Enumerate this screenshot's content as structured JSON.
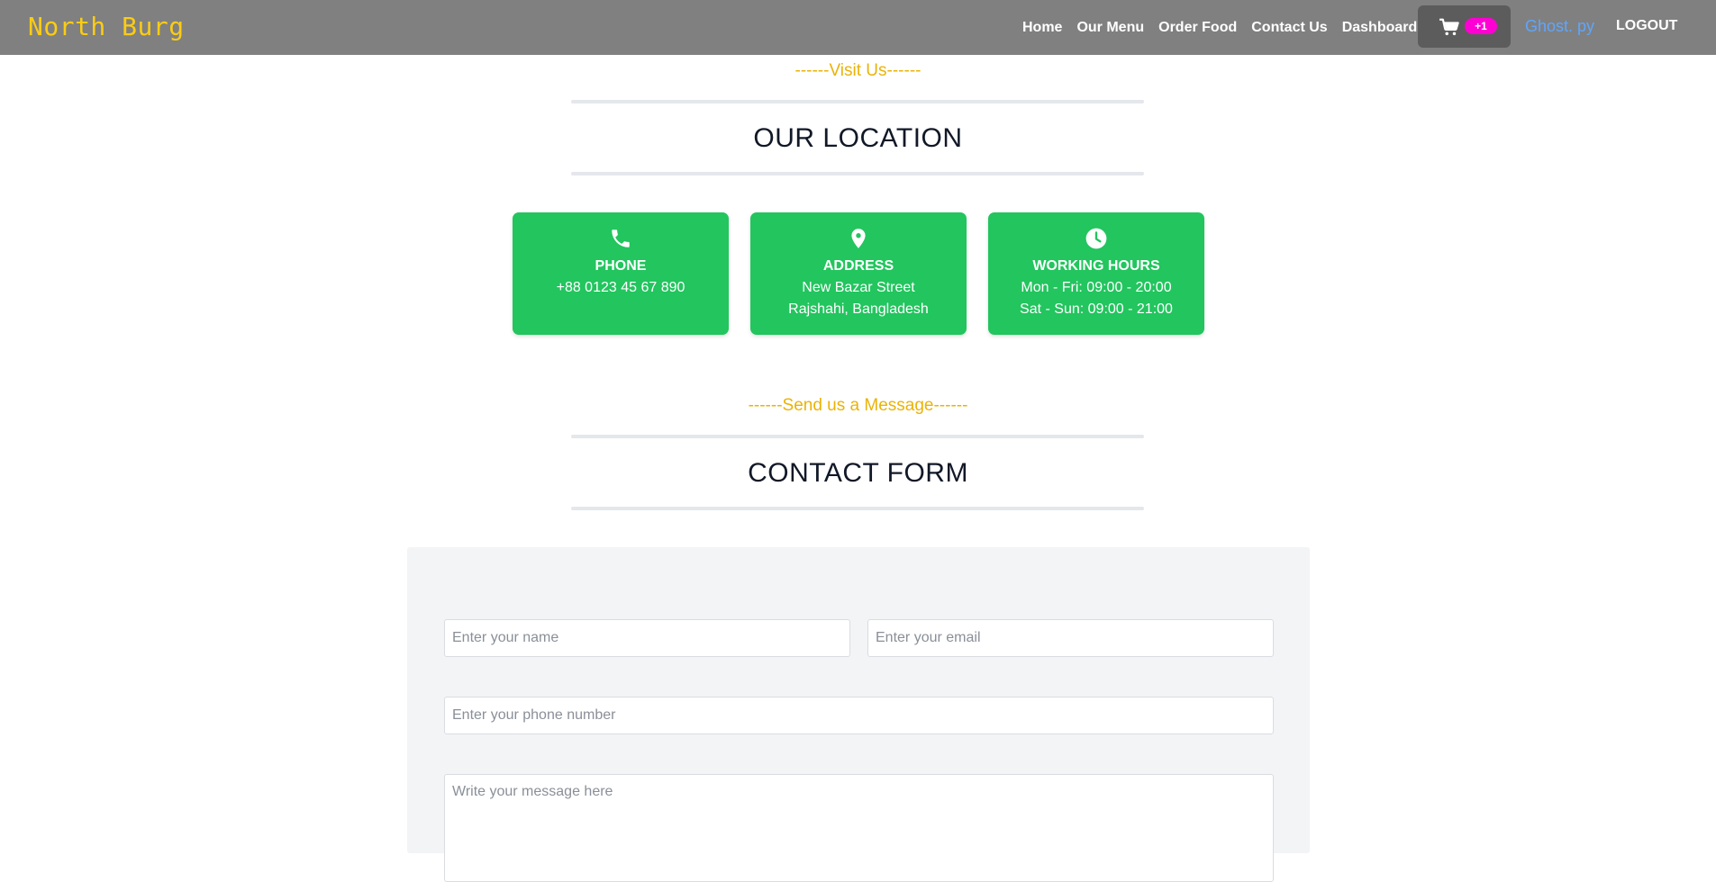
{
  "nav": {
    "brand": "North Burg",
    "links": [
      "Home",
      "Our Menu",
      "Order Food",
      "Contact Us",
      "Dashboard"
    ],
    "cart_icon": "cart-icon",
    "cart_badge": "+1",
    "user": "Ghost. py",
    "logout": "LOGOUT"
  },
  "location_section": {
    "eyebrow": "------Visit Us------",
    "title": "OUR LOCATION"
  },
  "cards": [
    {
      "icon": "phone-icon",
      "title": "PHONE",
      "lines": [
        "+88 0123 45 67 890"
      ]
    },
    {
      "icon": "map-pin-icon",
      "title": "ADDRESS",
      "lines": [
        "New Bazar Street",
        "Rajshahi, Bangladesh"
      ]
    },
    {
      "icon": "clock-icon",
      "title": "WORKING HOURS",
      "lines": [
        "Mon - Fri: 09:00 - 20:00",
        "Sat - Sun: 09:00 - 21:00"
      ]
    }
  ],
  "contact_section": {
    "eyebrow": "------Send us a Message------",
    "title": "CONTACT FORM"
  },
  "form": {
    "name_placeholder": "Enter your name",
    "email_placeholder": "Enter your email",
    "phone_placeholder": "Enter your phone number",
    "message_placeholder": "Write your message here"
  },
  "colors": {
    "navbar": "#808080",
    "brand": "#facc15",
    "accent_green": "#22c55e",
    "eyebrow": "#eab308",
    "badge": "#ff00d4",
    "user_link": "#60a5fa"
  }
}
